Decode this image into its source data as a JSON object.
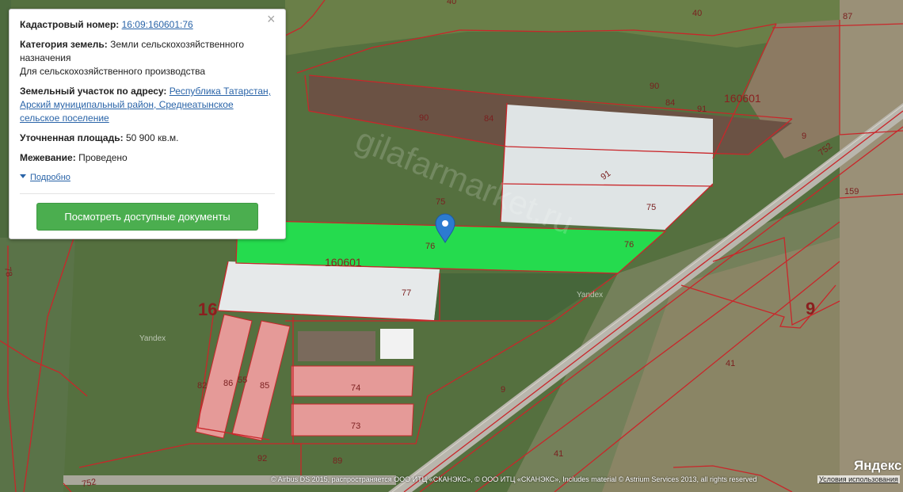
{
  "popup": {
    "cadastral_label": "Кадастровый номер:",
    "cadastral_value": "16:09:160601:76",
    "category_label": "Категория земель:",
    "category_value_1": "Земли сельскохозяйственного",
    "category_value_2": "назначения",
    "category_value_3": "Для сельскохозяйственного производства",
    "address_label": "Земельный участок по адресу:",
    "address_value_1": "Республика Татарстан,",
    "address_value_2": "Арский муниципальный район, Среднеатынское",
    "address_value_3": "сельское поселение",
    "area_label": "Уточненная площадь:",
    "area_value": "50 900 кв.м.",
    "survey_label": "Межевание:",
    "survey_value": "Проведено",
    "more_label": "Подробно",
    "docs_button": "Посмотреть доступные документы",
    "close_glyph": "×"
  },
  "parcel_labels": {
    "p40a": "40",
    "p40b": "40",
    "p87": "87",
    "p90a": "90",
    "p90b": "90",
    "p84a": "84",
    "p84b": "84",
    "p91a": "91",
    "p91b": "91",
    "q160601a": "160601",
    "q160601b": "160601",
    "p9a": "9",
    "p9b": "9",
    "p9c": "9",
    "p752a": "752",
    "p752b": "752",
    "p159": "159",
    "p75a": "75",
    "p75b": "75",
    "p76a": "76",
    "p76b": "76",
    "p77": "77",
    "p74": "74",
    "p73": "73",
    "p82": "82",
    "p86": "86",
    "p55": "55",
    "p85": "85",
    "p92": "92",
    "p89": "89",
    "p41a": "41",
    "p41b": "41",
    "q16": "16",
    "p78": "78"
  },
  "map_text": {
    "yandex_a": "Yandex",
    "yandex_b": "Yandex",
    "watermark": "gilafarmarket.ru"
  },
  "footer": {
    "attribution": "© Airbus DS 2015, распространяется ООО ИТЦ «СКАНЭКС», © ООО ИТЦ «СКАНЭКС», Includes material © Astrium Services 2013, all rights reserved",
    "terms": "Условия использования",
    "logo": "Яндекс"
  },
  "colors": {
    "selected_parcel": "#22e44f",
    "parcel_border": "#c9262a",
    "building_fill": "#e59a98",
    "button": "#4bae4f",
    "link": "#2a64a8"
  },
  "marker_icon": "map-pin-icon"
}
